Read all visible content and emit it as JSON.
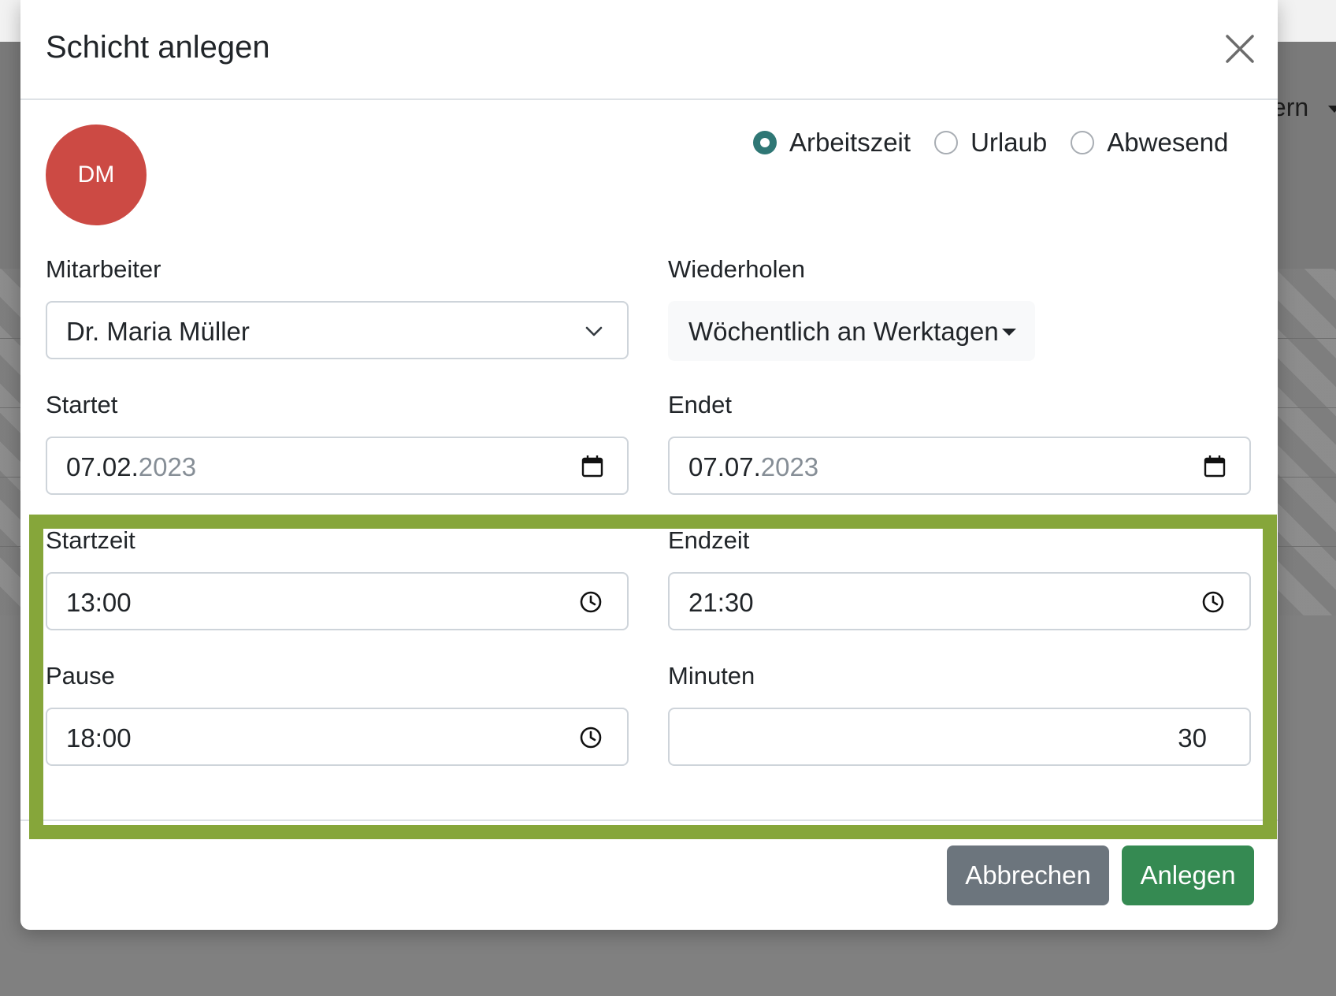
{
  "background": {
    "menu_text": "tern"
  },
  "modal": {
    "title": "Schicht anlegen",
    "avatar_initials": "DM",
    "type_options": [
      {
        "label": "Arbeitszeit",
        "checked": true
      },
      {
        "label": "Urlaub",
        "checked": false
      },
      {
        "label": "Abwesend",
        "checked": false
      }
    ],
    "employee": {
      "label": "Mitarbeiter",
      "value": "Dr. Maria Müller"
    },
    "repeat": {
      "label": "Wiederholen",
      "value": "Wöchentlich an Werktagen"
    },
    "start_date": {
      "label": "Startet",
      "value_main": "07.02.",
      "value_year": "2023"
    },
    "end_date": {
      "label": "Endet",
      "value_main": "07.07.",
      "value_year": "2023"
    },
    "start_time": {
      "label": "Startzeit",
      "value": "13:00"
    },
    "end_time": {
      "label": "Endzeit",
      "value": "21:30"
    },
    "pause": {
      "label": "Pause",
      "value": "18:00"
    },
    "minutes": {
      "label": "Minuten",
      "value": "30"
    },
    "cancel_label": "Abbrechen",
    "submit_label": "Anlegen"
  },
  "colors": {
    "avatar": "#cc4a44",
    "radio_checked": "#2f7775",
    "cancel_button": "#6c757d",
    "submit_button": "#358a52",
    "highlight": "#86a63a"
  },
  "icons": {
    "close": "close-icon",
    "select_chevron": "chevron-down-icon",
    "calendar": "calendar-icon",
    "clock": "clock-icon"
  }
}
